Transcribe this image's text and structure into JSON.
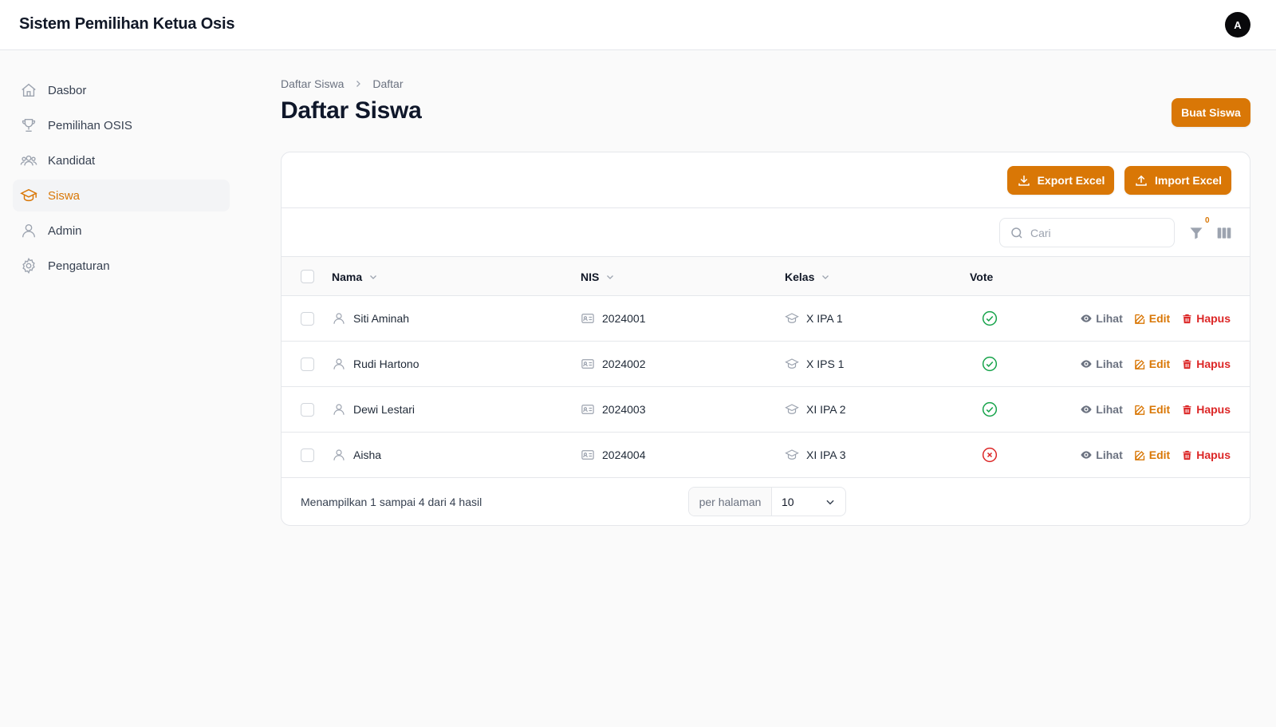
{
  "app": {
    "title": "Sistem Pemilihan Ketua Osis",
    "avatar_initial": "A"
  },
  "sidebar": {
    "items": [
      {
        "label": "Dasbor",
        "icon": "home-icon",
        "active": false
      },
      {
        "label": "Pemilihan OSIS",
        "icon": "trophy-icon",
        "active": false
      },
      {
        "label": "Kandidat",
        "icon": "users-group-icon",
        "active": false
      },
      {
        "label": "Siswa",
        "icon": "graduation-cap-icon",
        "active": true
      },
      {
        "label": "Admin",
        "icon": "user-icon",
        "active": false
      },
      {
        "label": "Pengaturan",
        "icon": "gear-icon",
        "active": false
      }
    ]
  },
  "breadcrumb": {
    "parent": "Daftar Siswa",
    "current": "Daftar"
  },
  "page": {
    "title": "Daftar Siswa",
    "create_label": "Buat Siswa"
  },
  "card": {
    "export_label": "Export Excel",
    "import_label": "Import Excel"
  },
  "toolbar": {
    "search_placeholder": "Cari",
    "filter_count": "0"
  },
  "table": {
    "columns": {
      "name": "Nama",
      "nis": "NIS",
      "kelas": "Kelas",
      "vote": "Vote"
    },
    "rows": [
      {
        "name": "Siti Aminah",
        "nis": "2024001",
        "kelas": "X IPA 1",
        "voted": true
      },
      {
        "name": "Rudi Hartono",
        "nis": "2024002",
        "kelas": "X IPS 1",
        "voted": true
      },
      {
        "name": "Dewi Lestari",
        "nis": "2024003",
        "kelas": "XI IPA 2",
        "voted": true
      },
      {
        "name": "Aisha",
        "nis": "2024004",
        "kelas": "XI IPA 3",
        "voted": false
      }
    ],
    "actions": {
      "view": "Lihat",
      "edit": "Edit",
      "delete": "Hapus"
    }
  },
  "footer": {
    "result_text": "Menampilkan 1 sampai 4 dari 4 hasil",
    "per_page_label": "per halaman",
    "per_page_value": "10"
  },
  "colors": {
    "accent": "#d97706",
    "danger": "#dc2626",
    "success": "#16a34a"
  }
}
